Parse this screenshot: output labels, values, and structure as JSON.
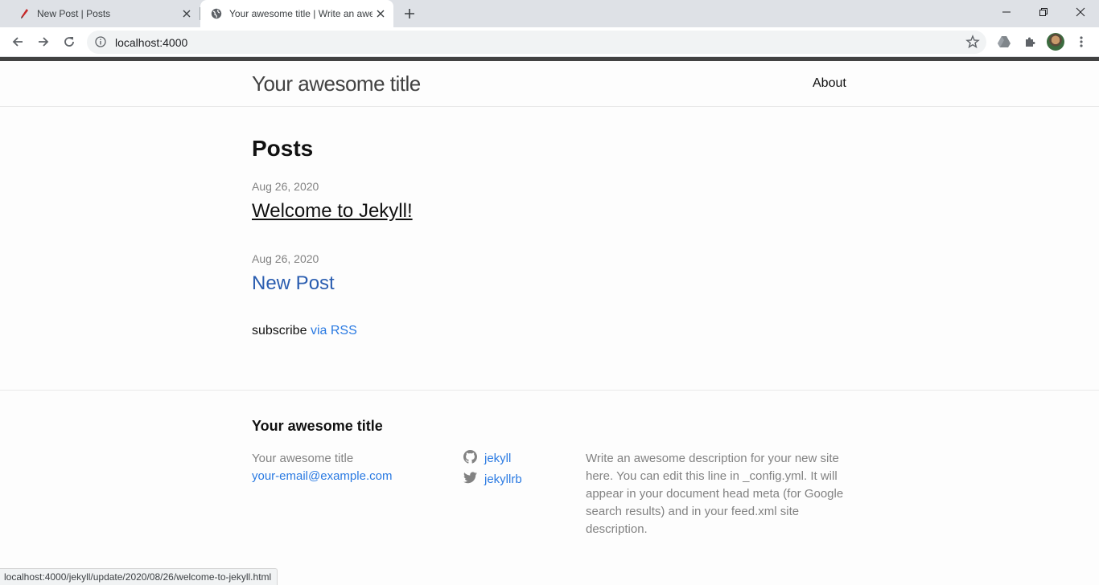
{
  "browser": {
    "tabs": [
      {
        "title": "New Post | Posts",
        "favicon": "red-pen-icon"
      },
      {
        "title": "Your awesome title | Write an awe",
        "favicon": "globe-icon"
      }
    ],
    "url": "localhost:4000",
    "status_url": "localhost:4000/jekyll/update/2020/08/26/welcome-to-jekyll.html"
  },
  "header": {
    "site_title": "Your awesome title",
    "nav": [
      {
        "label": "About"
      }
    ]
  },
  "main": {
    "heading": "Posts",
    "posts": [
      {
        "date": "Aug 26, 2020",
        "title": "Welcome to Jekyll!"
      },
      {
        "date": "Aug 26, 2020",
        "title": "New Post"
      }
    ],
    "subscribe_prefix": "subscribe",
    "subscribe_link": "via RSS"
  },
  "footer": {
    "heading": "Your awesome title",
    "name": "Your awesome title",
    "email": "your-email@example.com",
    "social": [
      {
        "icon": "github-icon",
        "label": "jekyll"
      },
      {
        "icon": "twitter-icon",
        "label": "jekyllrb"
      }
    ],
    "description": "Write an awesome description for your new site here. You can edit this line in _config.yml. It will appear in your document head meta (for Google search results) and in your feed.xml site description."
  },
  "colors": {
    "link": "#2a7ae2",
    "muted": "#828282",
    "accent_bar": "#424242"
  }
}
